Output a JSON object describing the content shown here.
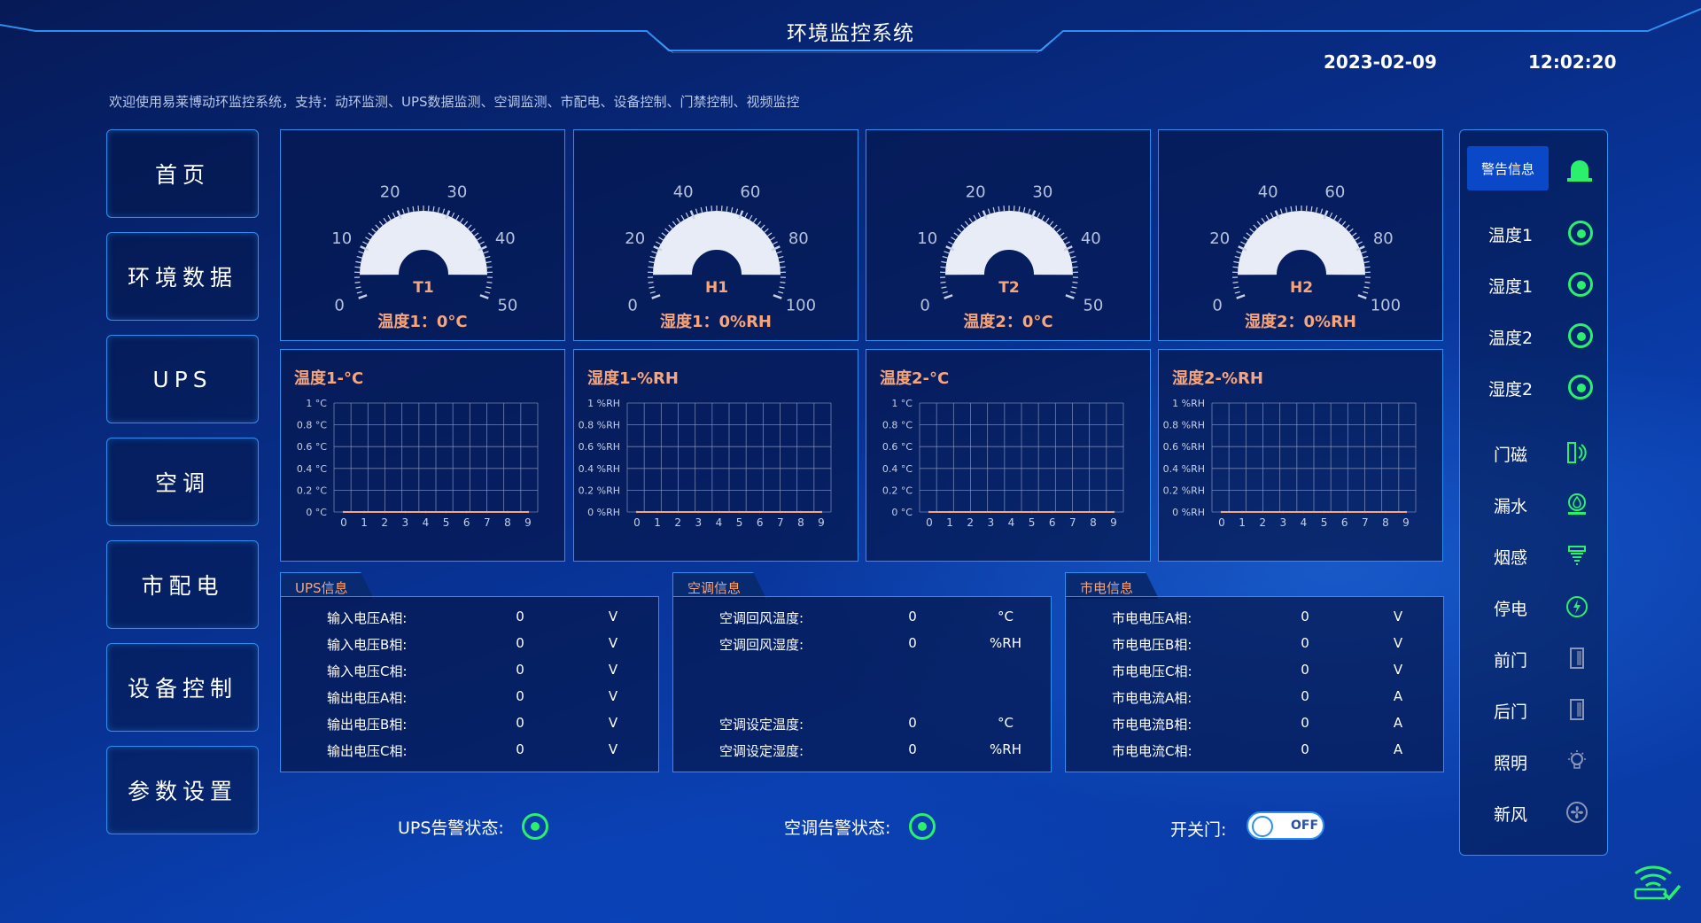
{
  "header": {
    "title": "环境监控系统",
    "date": "2023-02-09",
    "time": "12:02:20",
    "welcome": "欢迎使用易莱博动环监控系统，支持：动环监测、UPS数据监测、空调监测、市配电、设备控制、门禁控制、视频监控"
  },
  "nav": {
    "items": [
      {
        "label": "首页"
      },
      {
        "label": "环境数据"
      },
      {
        "label": "UPS"
      },
      {
        "label": "空调"
      },
      {
        "label": "市配电"
      },
      {
        "label": "设备控制"
      },
      {
        "label": "参数设置"
      }
    ]
  },
  "gauges": [
    {
      "name": "T1",
      "caption": "温度1：0°C",
      "ticks": [
        "0",
        "10",
        "20",
        "30",
        "40",
        "50"
      ],
      "min": 0,
      "max": 50,
      "value": 0
    },
    {
      "name": "H1",
      "caption": "湿度1：0%RH",
      "ticks": [
        "0",
        "20",
        "40",
        "60",
        "80",
        "100"
      ],
      "min": 0,
      "max": 100,
      "value": 0
    },
    {
      "name": "T2",
      "caption": "温度2：0°C",
      "ticks": [
        "0",
        "10",
        "20",
        "30",
        "40",
        "50"
      ],
      "min": 0,
      "max": 50,
      "value": 0
    },
    {
      "name": "H2",
      "caption": "湿度2：0%RH",
      "ticks": [
        "0",
        "20",
        "40",
        "60",
        "80",
        "100"
      ],
      "min": 0,
      "max": 100,
      "value": 0
    }
  ],
  "chart_data": [
    {
      "type": "line",
      "title": "温度1-°C",
      "x": [
        0,
        1,
        2,
        3,
        4,
        5,
        6,
        7,
        8,
        9
      ],
      "y_ticks": [
        "0 °C",
        "0.2 °C",
        "0.4 °C",
        "0.6 °C",
        "0.8 °C",
        "1 °C"
      ],
      "ylim": [
        0,
        1
      ],
      "series": [
        {
          "values": [
            0,
            0,
            0,
            0,
            0,
            0,
            0,
            0,
            0,
            0
          ]
        }
      ],
      "grid": true
    },
    {
      "type": "line",
      "title": "湿度1-%RH",
      "x": [
        0,
        1,
        2,
        3,
        4,
        5,
        6,
        7,
        8,
        9
      ],
      "y_ticks": [
        "0 %RH",
        "0.2 %RH",
        "0.4 %RH",
        "0.6 %RH",
        "0.8 %RH",
        "1 %RH"
      ],
      "ylim": [
        0,
        1
      ],
      "series": [
        {
          "values": [
            0,
            0,
            0,
            0,
            0,
            0,
            0,
            0,
            0,
            0
          ]
        }
      ],
      "grid": true
    },
    {
      "type": "line",
      "title": "温度2-°C",
      "x": [
        0,
        1,
        2,
        3,
        4,
        5,
        6,
        7,
        8,
        9
      ],
      "y_ticks": [
        "0 °C",
        "0.2 °C",
        "0.4 °C",
        "0.6 °C",
        "0.8 °C",
        "1 °C"
      ],
      "ylim": [
        0,
        1
      ],
      "series": [
        {
          "values": [
            0,
            0,
            0,
            0,
            0,
            0,
            0,
            0,
            0,
            0
          ]
        }
      ],
      "grid": true
    },
    {
      "type": "line",
      "title": "湿度2-%RH",
      "x": [
        0,
        1,
        2,
        3,
        4,
        5,
        6,
        7,
        8,
        9
      ],
      "y_ticks": [
        "0 %RH",
        "0.2 %RH",
        "0.4 %RH",
        "0.6 %RH",
        "0.8 %RH",
        "1 %RH"
      ],
      "ylim": [
        0,
        1
      ],
      "series": [
        {
          "values": [
            0,
            0,
            0,
            0,
            0,
            0,
            0,
            0,
            0,
            0
          ]
        }
      ],
      "grid": true
    }
  ],
  "info": {
    "ups": {
      "title": "UPS信息",
      "rows": [
        {
          "label": "输入电压A相:",
          "value": "0",
          "unit": "V"
        },
        {
          "label": "输入电压B相:",
          "value": "0",
          "unit": "V"
        },
        {
          "label": "输入电压C相:",
          "value": "0",
          "unit": "V"
        },
        {
          "label": "输出电压A相:",
          "value": "0",
          "unit": "V"
        },
        {
          "label": "输出电压B相:",
          "value": "0",
          "unit": "V"
        },
        {
          "label": "输出电压C相:",
          "value": "0",
          "unit": "V"
        }
      ]
    },
    "aircon": {
      "title": "空调信息",
      "rows": [
        {
          "label": "空调回风温度:",
          "value": "0",
          "unit": "°C"
        },
        {
          "label": "空调回风湿度:",
          "value": "0",
          "unit": "%RH"
        },
        {
          "label": "空调设定温度:",
          "value": "0",
          "unit": "°C"
        },
        {
          "label": "空调设定湿度:",
          "value": "0",
          "unit": "%RH"
        }
      ]
    },
    "power": {
      "title": "市电信息",
      "rows": [
        {
          "label": "市电电压A相:",
          "value": "0",
          "unit": "V"
        },
        {
          "label": "市电电压B相:",
          "value": "0",
          "unit": "V"
        },
        {
          "label": "市电电压C相:",
          "value": "0",
          "unit": "V"
        },
        {
          "label": "市电电流A相:",
          "value": "0",
          "unit": "A"
        },
        {
          "label": "市电电流B相:",
          "value": "0",
          "unit": "A"
        },
        {
          "label": "市电电流C相:",
          "value": "0",
          "unit": "A"
        }
      ]
    }
  },
  "status": {
    "ups_alarm_label": "UPS告警状态:",
    "aircon_alarm_label": "空调告警状态:",
    "door_label": "开关门:",
    "door_toggle": "OFF"
  },
  "alarms": {
    "button": "警告信息",
    "sensors": [
      {
        "label": "温度1",
        "icon": "status-ring-icon"
      },
      {
        "label": "湿度1",
        "icon": "status-ring-icon"
      },
      {
        "label": "温度2",
        "icon": "status-ring-icon"
      },
      {
        "label": "湿度2",
        "icon": "status-ring-icon"
      }
    ],
    "devices": [
      {
        "label": "门磁",
        "icon": "door-sensor-icon"
      },
      {
        "label": "漏水",
        "icon": "water-leak-icon"
      },
      {
        "label": "烟感",
        "icon": "smoke-detector-icon"
      },
      {
        "label": "停电",
        "icon": "power-outage-icon"
      },
      {
        "label": "前门",
        "icon": "front-door-icon"
      },
      {
        "label": "后门",
        "icon": "back-door-icon"
      },
      {
        "label": "照明",
        "icon": "bulb-icon"
      },
      {
        "label": "新风",
        "icon": "fan-icon"
      }
    ]
  },
  "colors": {
    "accent": "#2f8ff0",
    "caption": "#f7a57b",
    "ok": "#2bf06b",
    "gauge_fill": "#e8ecf6"
  }
}
